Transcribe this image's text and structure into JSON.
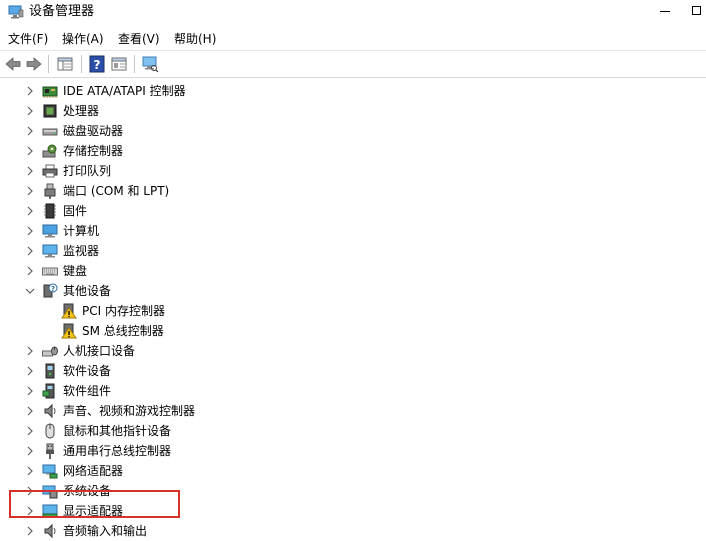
{
  "window": {
    "title": "设备管理器"
  },
  "menu": [
    {
      "label": "文件(F)"
    },
    {
      "label": "操作(A)"
    },
    {
      "label": "查看(V)"
    },
    {
      "label": "帮助(H)"
    }
  ],
  "tree": {
    "items": [
      {
        "label": "IDE ATA/ATAPI 控制器",
        "icon": "ide-controller-icon",
        "expanded": false
      },
      {
        "label": "处理器",
        "icon": "processor-icon",
        "expanded": false
      },
      {
        "label": "磁盘驱动器",
        "icon": "disk-drive-icon",
        "expanded": false
      },
      {
        "label": "存储控制器",
        "icon": "storage-controller-icon",
        "expanded": false
      },
      {
        "label": "打印队列",
        "icon": "printer-icon",
        "expanded": false
      },
      {
        "label": "端口 (COM 和 LPT)",
        "icon": "port-icon",
        "expanded": false
      },
      {
        "label": "固件",
        "icon": "firmware-icon",
        "expanded": false
      },
      {
        "label": "计算机",
        "icon": "computer-icon",
        "expanded": false
      },
      {
        "label": "监视器",
        "icon": "monitor-icon",
        "expanded": false
      },
      {
        "label": "键盘",
        "icon": "keyboard-icon",
        "expanded": false
      },
      {
        "label": "其他设备",
        "icon": "other-devices-icon",
        "expanded": true,
        "children": [
          {
            "label": "PCI 内存控制器",
            "icon": "warning-device-icon"
          },
          {
            "label": "SM 总线控制器",
            "icon": "warning-device-icon"
          }
        ]
      },
      {
        "label": "人机接口设备",
        "icon": "hid-icon",
        "expanded": false
      },
      {
        "label": "软件设备",
        "icon": "software-device-icon",
        "expanded": false
      },
      {
        "label": "软件组件",
        "icon": "software-component-icon",
        "expanded": false
      },
      {
        "label": "声音、视频和游戏控制器",
        "icon": "audio-icon",
        "expanded": false
      },
      {
        "label": "鼠标和其他指针设备",
        "icon": "mouse-icon",
        "expanded": false
      },
      {
        "label": "通用串行总线控制器",
        "icon": "usb-icon",
        "expanded": false
      },
      {
        "label": "网络适配器",
        "icon": "network-icon",
        "expanded": false
      },
      {
        "label": "系统设备",
        "icon": "system-device-icon",
        "expanded": false
      },
      {
        "label": "显示适配器",
        "icon": "display-adapter-icon",
        "expanded": false,
        "highlighted": true
      },
      {
        "label": "音频输入和输出",
        "icon": "audio-io-icon",
        "expanded": false
      }
    ]
  },
  "colors": {
    "highlight_border": "#d9302c",
    "chevron": "#606060"
  }
}
